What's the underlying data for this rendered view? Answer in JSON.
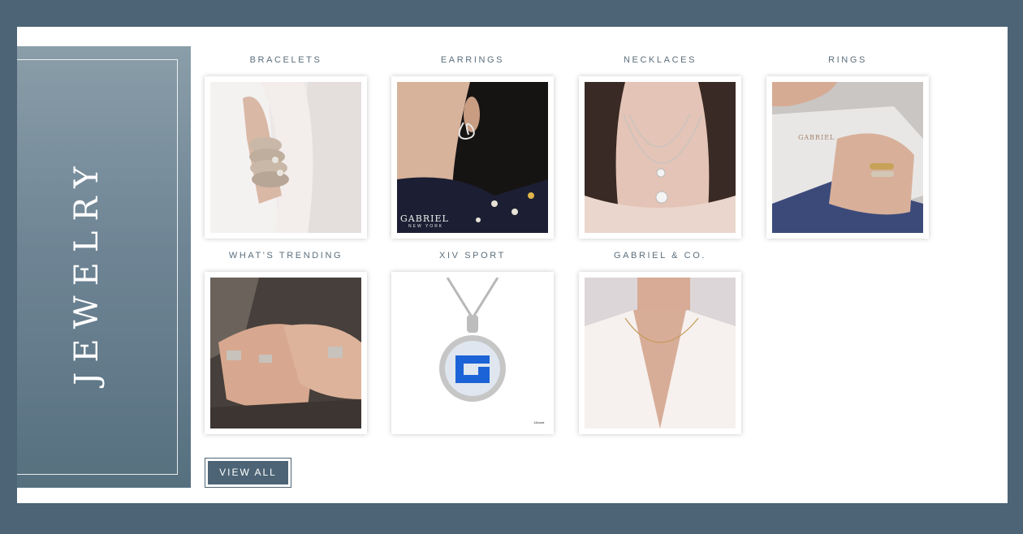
{
  "section": {
    "title": "JEWELRY"
  },
  "categories": [
    {
      "label": "BRACELETS"
    },
    {
      "label": "EARRINGS"
    },
    {
      "label": "NECKLACES"
    },
    {
      "label": "RINGS"
    },
    {
      "label": "WHAT'S TRENDING"
    },
    {
      "label": "XIV SPORT"
    },
    {
      "label": "GABRIEL & CO."
    }
  ],
  "image_text": {
    "earrings_brand": "GABRIEL",
    "earrings_brand_sub": "NEW YORK",
    "rings_box_brand": "GABRIEL",
    "sport_tag": "14karat"
  },
  "cta": {
    "view_all_label": "VIEW ALL"
  },
  "colors": {
    "page_bg": "#4c6475",
    "banner_top": "#8a9ea9",
    "banner_bottom": "#56707f",
    "button": "#4c6475"
  }
}
